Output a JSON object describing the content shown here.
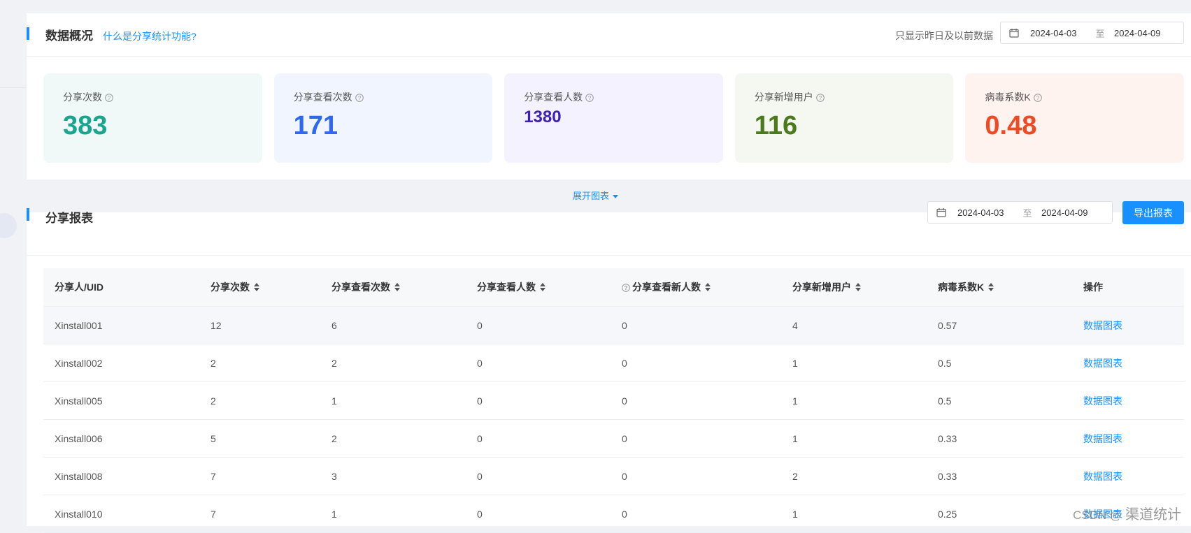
{
  "overview": {
    "title": "数据概况",
    "help_link": "什么是分享统计功能?",
    "note": "只显示昨日及以前数据",
    "date_start": "2024-04-03",
    "date_sep": "至",
    "date_end": "2024-04-09",
    "cards": [
      {
        "label": "分享次数",
        "value": "383",
        "bg": "#f0f9f7",
        "color": "#1aa58e"
      },
      {
        "label": "分享查看次数",
        "value": "171",
        "bg": "#f0f5ff",
        "color": "#2e68f0"
      },
      {
        "label": "分享查看人数",
        "value": "1380",
        "bg": "#f4f2fe",
        "color": "#3d1fb8"
      },
      {
        "label": "分享新增用户",
        "value": "116",
        "bg": "#f5f8f1",
        "color": "#4a7a1c"
      },
      {
        "label": "病毒系数K",
        "value": "0.48",
        "bg": "#fff3ef",
        "color": "#f04a24"
      }
    ]
  },
  "expand_label": "展开图表",
  "report": {
    "title": "分享报表",
    "date_start": "2024-04-03",
    "date_sep": "至",
    "date_end": "2024-04-09",
    "export_label": "导出报表",
    "columns": [
      "分享人/UID",
      "分享次数",
      "分享查看次数",
      "分享查看人数",
      "分享查看新人数",
      "分享新增用户",
      "病毒系数K",
      "操作"
    ],
    "rows": [
      [
        "Xinstall001",
        "12",
        "6",
        "0",
        "0",
        "4",
        "0.57",
        "数据图表"
      ],
      [
        "Xinstall002",
        "2",
        "2",
        "0",
        "0",
        "1",
        "0.5",
        "数据图表"
      ],
      [
        "Xinstall005",
        "2",
        "1",
        "0",
        "0",
        "1",
        "0.5",
        "数据图表"
      ],
      [
        "Xinstall006",
        "5",
        "2",
        "0",
        "0",
        "1",
        "0.33",
        "数据图表"
      ],
      [
        "Xinstall008",
        "7",
        "3",
        "0",
        "0",
        "2",
        "0.33",
        "数据图表"
      ],
      [
        "Xinstall010",
        "7",
        "1",
        "0",
        "0",
        "1",
        "0.25",
        "数据图表"
      ]
    ]
  },
  "watermark": {
    "prefix": "CSDN @",
    "suffix": "渠道统计"
  },
  "colors": {
    "accent": "#1890ff"
  }
}
